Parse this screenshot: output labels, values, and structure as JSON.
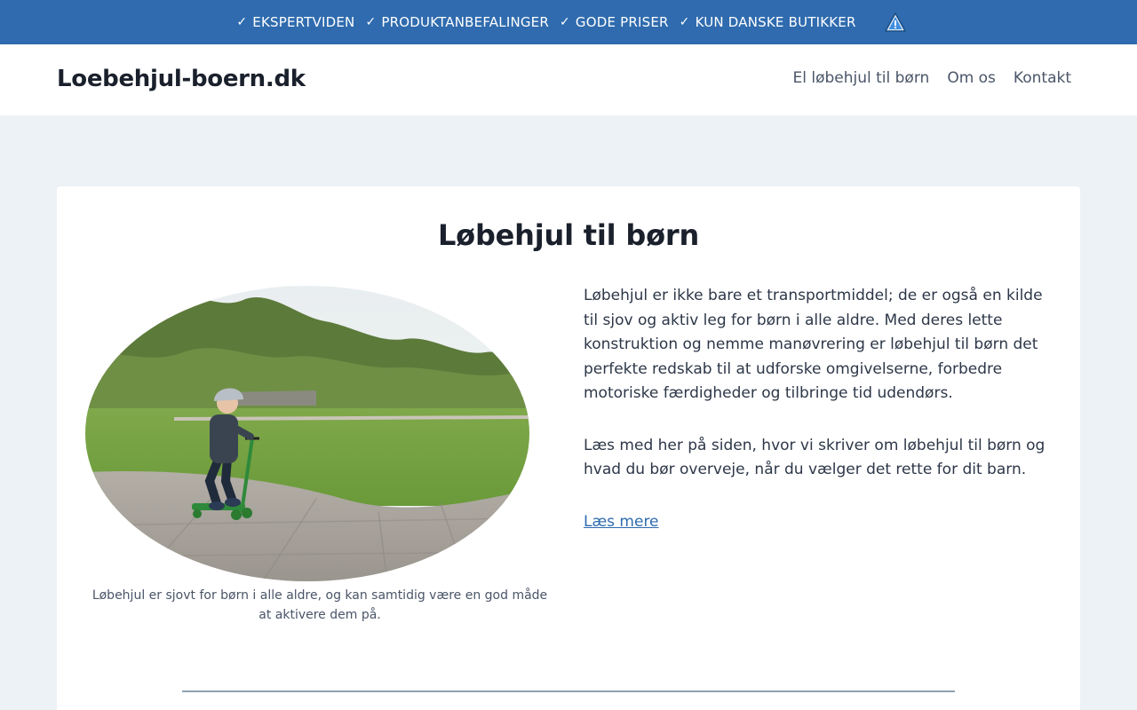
{
  "topbar": {
    "items": [
      {
        "check": "✓",
        "label": "EKSPERTVIDEN"
      },
      {
        "check": "✓",
        "label": "PRODUKTANBEFALINGER"
      },
      {
        "check": "✓",
        "label": "GODE PRISER"
      },
      {
        "check": "✓",
        "label": "KUN DANSKE BUTIKKER"
      }
    ],
    "warning_icon": "warning-icon"
  },
  "header": {
    "logo": "Loebehjul-boern.dk",
    "nav": [
      "El løbehjul til børn",
      "Om os",
      "Kontakt"
    ]
  },
  "main": {
    "title": "Løbehjul til børn",
    "image": "child-on-scooter-photo",
    "caption": "Løbehjul er sjovt for børn i alle aldre, og kan samtidig være en god måde at aktivere dem på.",
    "paragraphs": [
      "Løbehjul er ikke bare et transportmiddel; de er også en kilde til sjov og aktiv leg for børn i alle aldre. Med deres lette konstruktion og nemme manøvrering er løbehjul til børn det perfekte redskab til at udforske omgivelserne, forbedre motoriske færdigheder og tilbringe tid udendørs.",
      "Læs med her på siden, hvor vi skriver om løbehjul til børn og hvad du bør overveje, når du vælger det rette for dit barn."
    ],
    "read_more": "Læs mere"
  },
  "colors": {
    "topbar_bg": "#2f6bae",
    "page_bg": "#edf2f7",
    "link": "#2f6bae"
  }
}
